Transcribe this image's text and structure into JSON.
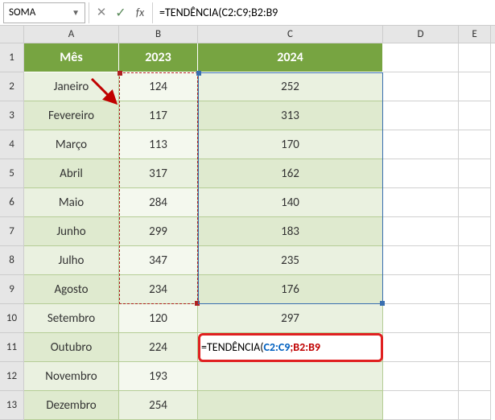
{
  "name_box": "SOMA",
  "formula_bar": "=TENDÊNCIA(C2:C9;B2:B9",
  "columns": [
    "A",
    "B",
    "C",
    "D",
    "E"
  ],
  "row_numbers": [
    "1",
    "2",
    "3",
    "4",
    "5",
    "6",
    "7",
    "8",
    "9",
    "10",
    "11",
    "12",
    "13"
  ],
  "table": {
    "headers": {
      "a": "Mês",
      "b": "2023",
      "c": "2024"
    },
    "rows": [
      {
        "a": "Janeiro",
        "b": "124",
        "c": "252"
      },
      {
        "a": "Fevereiro",
        "b": "117",
        "c": "313"
      },
      {
        "a": "Março",
        "b": "113",
        "c": "170"
      },
      {
        "a": "Abril",
        "b": "317",
        "c": "162"
      },
      {
        "a": "Maio",
        "b": "284",
        "c": "140"
      },
      {
        "a": "Junho",
        "b": "299",
        "c": "183"
      },
      {
        "a": "Julho",
        "b": "347",
        "c": "235"
      },
      {
        "a": "Agosto",
        "b": "234",
        "c": "176"
      },
      {
        "a": "Setembro",
        "b": "120",
        "c": "297"
      },
      {
        "a": "Outubro",
        "b": "224",
        "c": ""
      },
      {
        "a": "Novembro",
        "b": "193",
        "c": ""
      },
      {
        "a": "Dezembro",
        "b": "254",
        "c": ""
      }
    ]
  },
  "cell_formula": {
    "eq": "=",
    "fn": "TENDÊNCIA(",
    "arg1": "C2:C9",
    "sep": ";",
    "arg2": "B2:B9"
  }
}
